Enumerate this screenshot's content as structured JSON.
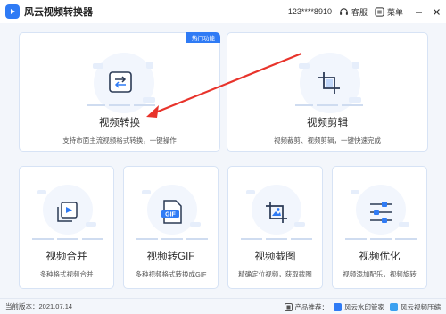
{
  "app": {
    "title": "风云视频转换器",
    "user_id": "123****8910",
    "service_label": "客服",
    "menu_label": "菜单"
  },
  "featured": {
    "convert": {
      "badge": "热门功能",
      "title": "视频转换",
      "desc": "支持市面主流视频格式转换，一键操作"
    },
    "edit": {
      "title": "视频剪辑",
      "desc": "视频裁剪、视频剪辑，一键快速完成"
    }
  },
  "tools": [
    {
      "title": "视频合并",
      "desc": "多种格式视频合并",
      "icon": "video-merge-icon"
    },
    {
      "title": "视频转GIF",
      "desc": "多种视频格式转换成GIF",
      "icon": "gif-icon",
      "icon_text": "GIF"
    },
    {
      "title": "视频截图",
      "desc": "精确定位视频，获取截图",
      "icon": "screenshot-icon"
    },
    {
      "title": "视频优化",
      "desc": "视频添加配乐，视频旋转",
      "icon": "sliders-icon"
    }
  ],
  "footer": {
    "version": "当前版本：2021.07.14",
    "recommend_label": "产品推荐：",
    "products": [
      "风云水印管家",
      "风云视频压缩"
    ]
  },
  "colors": {
    "accent": "#2f7bf5",
    "arrow": "#e8332b",
    "card_border": "#d7e3f5",
    "background": "#f3f6fb"
  }
}
